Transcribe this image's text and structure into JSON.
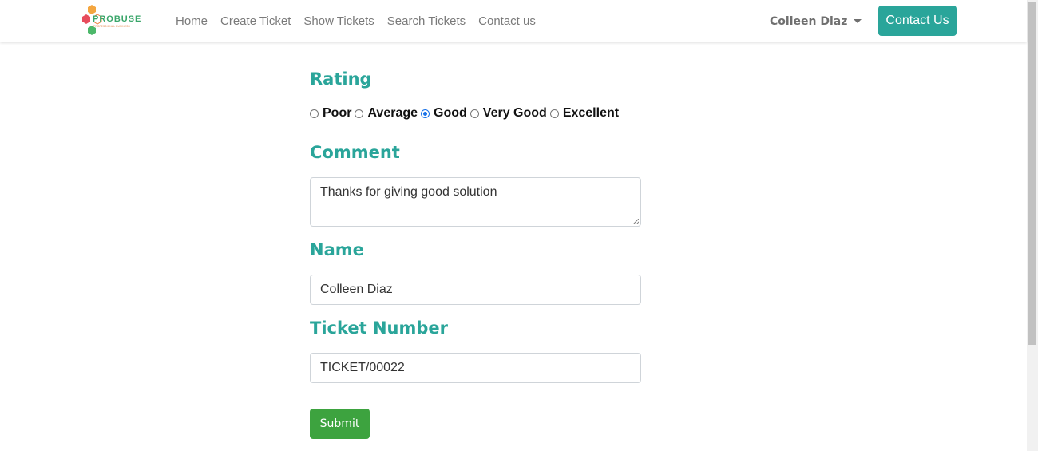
{
  "navbar": {
    "logo": {
      "brand_text": "PROBUSE",
      "tagline": "PROFESSIONAL BUSINESS"
    },
    "links": [
      {
        "label": "Home"
      },
      {
        "label": "Create Ticket"
      },
      {
        "label": "Show Tickets"
      },
      {
        "label": "Search Tickets"
      },
      {
        "label": "Contact us"
      }
    ],
    "user_name": "Colleen Diaz",
    "contact_button": "Contact Us"
  },
  "form": {
    "rating": {
      "title": "Rating",
      "options": [
        {
          "label": "Poor",
          "checked": false
        },
        {
          "label": "Average",
          "checked": false
        },
        {
          "label": "Good",
          "checked": true
        },
        {
          "label": "Very Good",
          "checked": false
        },
        {
          "label": "Excellent",
          "checked": false
        }
      ]
    },
    "comment": {
      "title": "Comment",
      "value": "Thanks for giving good solution"
    },
    "name": {
      "title": "Name",
      "value": "Colleen Diaz"
    },
    "ticket_number": {
      "title": "Ticket Number",
      "value": "TICKET/00022"
    },
    "submit_label": "Submit"
  },
  "colors": {
    "accent": "#2aa59a",
    "submit": "#3da33f",
    "radio_selected": "#1a73e8"
  }
}
